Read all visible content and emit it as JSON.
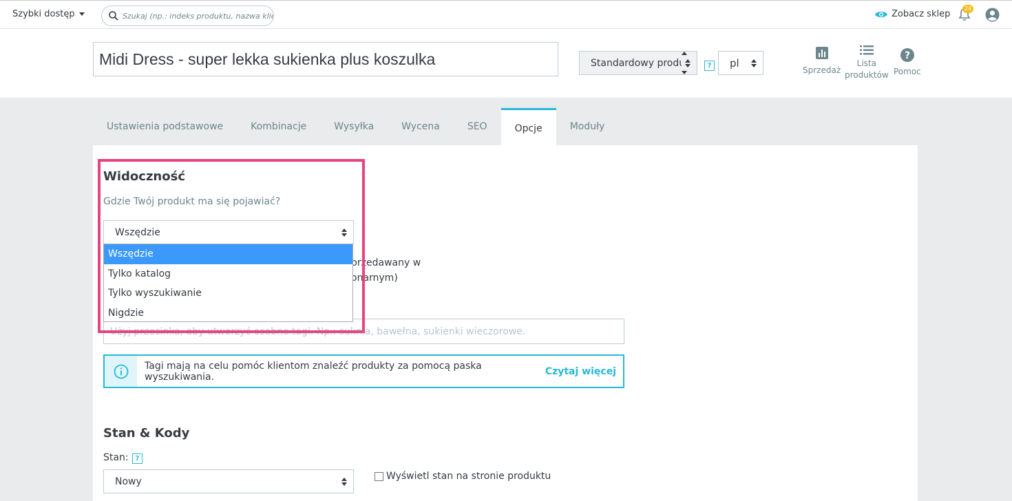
{
  "topbar": {
    "quick_access": "Szybki dostęp",
    "search_placeholder": "Szukaj (np.: indeks produktu, nazwa klienta...)",
    "view_shop": "Zobacz sklep",
    "notifications_count": "24"
  },
  "header": {
    "product_name": "Midi Dress - super lekka sukienka plus koszulka",
    "product_type": "Standardowy produkt",
    "help_mark": "?",
    "language": "pl",
    "buttons": {
      "sales": "Sprzedaż",
      "product_list_line1": "Lista",
      "product_list_line2": "produktów",
      "help": "Pomoc"
    }
  },
  "tabs": [
    {
      "label": "Ustawienia podstawowe",
      "active": false
    },
    {
      "label": "Kombinacje",
      "active": false
    },
    {
      "label": "Wysyłka",
      "active": false
    },
    {
      "label": "Wycena",
      "active": false
    },
    {
      "label": "SEO",
      "active": false
    },
    {
      "label": "Opcje",
      "active": true
    },
    {
      "label": "Moduły",
      "active": false
    }
  ],
  "visibility": {
    "heading": "Widoczność",
    "question": "Gdzie Twój produkt ma się pojawiać?",
    "selected": "Wszędzie",
    "options": [
      "Wszędzie",
      "Tylko katalog",
      "Tylko wyszukiwanie",
      "Nigdzie"
    ],
    "behind_line1": "przedawany w",
    "behind_line2": "onarnym)"
  },
  "tags": {
    "placeholder": "Użyj przecinka, aby utworzyć osobne tagi. Np.: suknia, bawełna, sukienki wieczorowe.",
    "info_text": "Tagi mają na celu pomóc klientom znaleźć produkty za pomocą paska wyszukiwania.",
    "read_more": "Czytaj więcej"
  },
  "condition": {
    "heading": "Stan & Kody",
    "label": "Stan:",
    "help_mark": "?",
    "selected": "Nowy",
    "show_condition_label": "Wyświetl stan na stronie produktu"
  },
  "colors": {
    "accent": "#25b9d7",
    "highlight": "#e5457e",
    "selected_option": "#3b99fc"
  }
}
